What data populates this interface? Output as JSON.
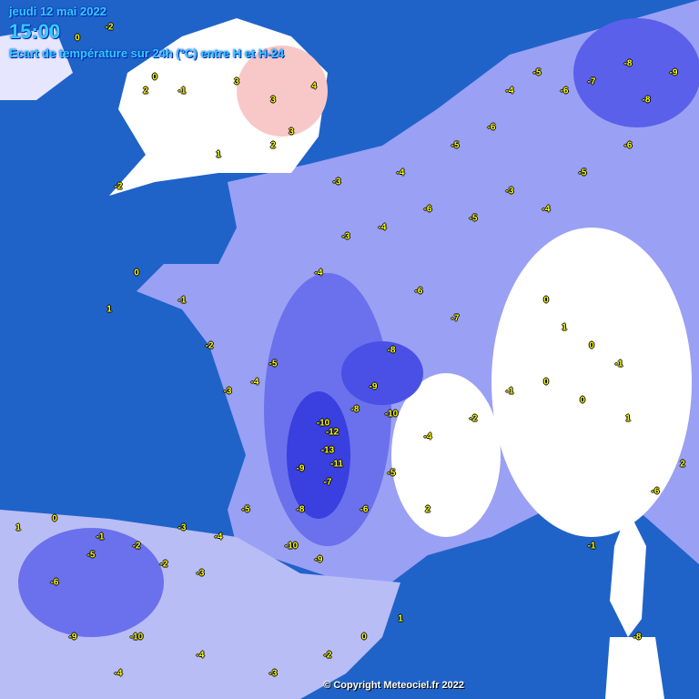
{
  "header": {
    "date": "jeudi 12 mai 2022",
    "time": "15:00",
    "subtitle": "Ecart de température sur 24h (°C) entre H et H-24"
  },
  "copyright": "© Copyright Meteociel.fr 2022",
  "colors": {
    "sea": "#1f63c9",
    "warm": "#f8c8c8",
    "neutral": "#ffffff",
    "cold_light": "#c8ccf8",
    "cold_mid": "#8a90f0",
    "cold_strong": "#3a3fe0",
    "label": "#ffff00"
  },
  "stations": [
    "-2",
    "0",
    "2",
    "3",
    "3",
    "4",
    "3",
    "2",
    "1",
    "-1",
    "0",
    "-2",
    "-3",
    "-4",
    "-5",
    "-6",
    "-4",
    "-5",
    "-6",
    "-7",
    "-8",
    "-9",
    "-8",
    "-6",
    "-5",
    "-4",
    "-3",
    "-5",
    "-6",
    "-4",
    "-3",
    "-4",
    "-6",
    "-7",
    "-8",
    "-9",
    "-10",
    "-12",
    "-13",
    "-11",
    "-9",
    "-8",
    "-10",
    "-7",
    "-5",
    "-4",
    "-3",
    "-2",
    "-1",
    "0",
    "1",
    "0",
    "1",
    "0",
    "-1",
    "0",
    "1",
    "2",
    "0",
    "-1",
    "-2",
    "-4",
    "-5",
    "-6",
    "-8",
    "-10",
    "-9",
    "-5",
    "-4",
    "-3",
    "-2",
    "-1",
    "0",
    "1",
    "-2",
    "-3",
    "-5",
    "-6",
    "-9",
    "-10",
    "-4",
    "-3",
    "-2",
    "0",
    "1",
    "2",
    "-1",
    "-6",
    "-8",
    "-4"
  ]
}
